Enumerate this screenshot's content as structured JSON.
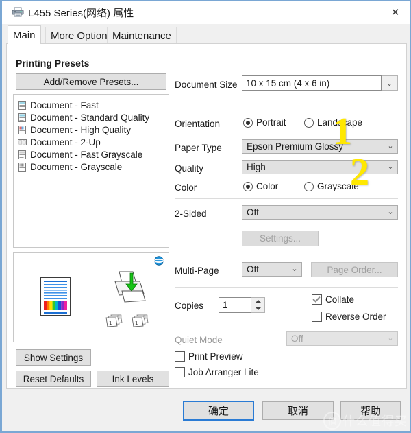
{
  "window": {
    "title": "L455 Series(网络) 属性",
    "printer_icon": "printer-icon",
    "close_label": "✕"
  },
  "tabs": [
    {
      "label": "Main",
      "selected": true
    },
    {
      "label": "More Options",
      "selected": false
    },
    {
      "label": "Maintenance",
      "selected": false
    }
  ],
  "left_panel": {
    "heading": "Printing Presets",
    "add_remove_button": "Add/Remove Presets...",
    "presets": [
      "Document - Fast",
      "Document - Standard Quality",
      "Document - High Quality",
      "Document - 2-Up",
      "Document - Fast Grayscale",
      "Document - Grayscale"
    ],
    "show_settings_button": "Show Settings",
    "reset_defaults_button": "Reset Defaults",
    "ink_levels_button": "Ink Levels"
  },
  "settings": {
    "document_size": {
      "label": "Document Size",
      "value": "10 x 15 cm (4 x 6 in)"
    },
    "orientation": {
      "label": "Orientation",
      "portrait": "Portrait",
      "landscape": "Landscape",
      "selected": "Portrait"
    },
    "paper_type": {
      "label": "Paper Type",
      "value": "Epson Premium Glossy"
    },
    "quality": {
      "label": "Quality",
      "value": "High"
    },
    "color": {
      "label": "Color",
      "color": "Color",
      "grayscale": "Grayscale",
      "selected": "Color"
    },
    "two_sided": {
      "label": "2-Sided",
      "value": "Off"
    },
    "settings_button": "Settings...",
    "multi_page": {
      "label": "Multi-Page",
      "value": "Off"
    },
    "page_order_button": "Page Order...",
    "copies": {
      "label": "Copies",
      "value": "1"
    },
    "collate": {
      "label": "Collate",
      "checked": true
    },
    "reverse_order": {
      "label": "Reverse Order",
      "checked": false
    },
    "quiet_mode": {
      "label": "Quiet Mode",
      "value": "Off",
      "disabled": true
    },
    "print_preview": {
      "label": "Print Preview",
      "checked": false
    },
    "job_arranger_lite": {
      "label": "Job Arranger Lite",
      "checked": false
    }
  },
  "footer": {
    "ok_button": "确定",
    "cancel_button": "取消",
    "help_button": "帮助"
  },
  "annotations": [
    {
      "text": "1",
      "note": "points at Paper Type row"
    },
    {
      "text": "2",
      "note": "points at Quality row"
    }
  ],
  "watermark": {
    "mark": "值",
    "text": "什么值得买"
  },
  "colors": {
    "accent_blue": "#2a7bd4",
    "window_border": "#7aa7d4",
    "dialog_bg": "#f0f0f0",
    "page_bg": "#ffffff",
    "control_bg": "#e1e1e1",
    "annotation_yellow": "#ffe800"
  }
}
